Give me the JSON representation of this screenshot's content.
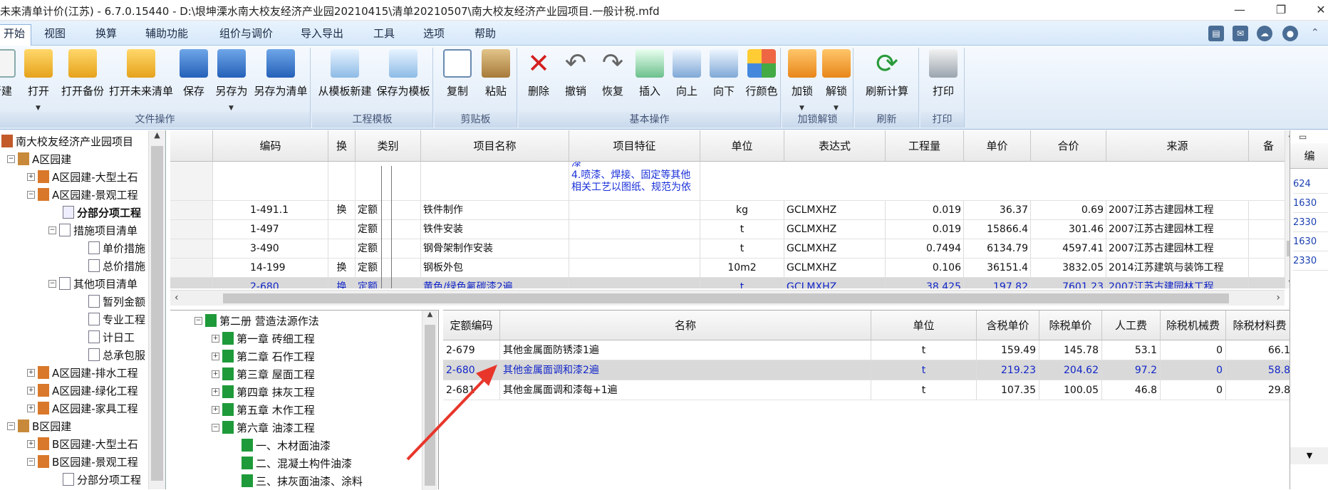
{
  "titlebar": {
    "text": "未来清单计价(江苏) - 6.7.0.15440 - D:\\垠坤溧水南大校友经济产业园20210415\\清单20210507\\南大校友经济产业园项目.一般计税.mfd"
  },
  "menu": [
    "开始",
    "视图",
    "换算",
    "辅助功能",
    "组价与调价",
    "导入导出",
    "工具",
    "选项",
    "帮助"
  ],
  "ribbon": {
    "groups": [
      "文件操作",
      "工程模板",
      "剪贴板",
      "基本操作",
      "加锁解锁",
      "刷新",
      "打印"
    ],
    "tools": [
      "新建",
      "打开",
      "打开备份",
      "打开未来清单",
      "保存",
      "另存为",
      "另存为清单",
      "从模板新建",
      "保存为模板",
      "复制",
      "粘贴",
      "删除",
      "撤销",
      "恢复",
      "插入",
      "向上",
      "向下",
      "行颜色",
      "加锁",
      "解锁",
      "刷新计算",
      "打印"
    ]
  },
  "tree": {
    "items": [
      "南大校友经济产业园项目",
      "A区园建",
      "A区园建-大型土石",
      "A区园建-景观工程",
      "分部分项工程",
      "措施项目清单",
      "单价措施",
      "总价措施",
      "其他项目清单",
      "暂列金额",
      "专业工程",
      "计日工",
      "总承包服",
      "A区园建-排水工程",
      "A区园建-绿化工程",
      "A区园建-家具工程",
      "B区园建",
      "B区园建-大型土石",
      "B区园建-景观工程",
      "分部分项工程"
    ]
  },
  "grid": {
    "headers": [
      "编码",
      "换",
      "类别",
      "项目名称",
      "项目特征",
      "单位",
      "表达式",
      "工程量",
      "单价",
      "合价",
      "来源",
      "备"
    ],
    "feature_text": [
      "漆",
      "4.喷漆、焊接、固定等其他",
      "相关工艺以图纸、规范为依"
    ],
    "rows": [
      {
        "code": "1-491.1",
        "swap": "换",
        "type": "定额",
        "name": "铁件制作",
        "unit": "kg",
        "expr": "GCLMXHZ",
        "qty": "0.019",
        "price": "36.37",
        "total": "0.69",
        "source": "2007江苏古建园林工程"
      },
      {
        "code": "1-497",
        "swap": "",
        "type": "定额",
        "name": "铁件安装",
        "unit": "t",
        "expr": "GCLMXHZ",
        "qty": "0.019",
        "price": "15866.4",
        "total": "301.46",
        "source": "2007江苏古建园林工程"
      },
      {
        "code": "3-490",
        "swap": "",
        "type": "定额",
        "name": "钢骨架制作安装",
        "unit": "t",
        "expr": "GCLMXHZ",
        "qty": "0.7494",
        "price": "6134.79",
        "total": "4597.41",
        "source": "2007江苏古建园林工程"
      },
      {
        "code": "14-199",
        "swap": "换",
        "type": "定额",
        "name": "钢板外包",
        "unit": "10m2",
        "expr": "GCLMXHZ",
        "qty": "0.106",
        "price": "36151.4",
        "total": "3832.05",
        "source": "2014江苏建筑与装饰工程"
      },
      {
        "code": "2-680",
        "swap": "换",
        "type": "定额",
        "name": "黄色/绿色氟碳漆2遍",
        "unit": "t",
        "expr": "GCLMXHZ",
        "qty": "38.425",
        "price": "197.82",
        "total": "7601.23",
        "source": "2007江苏古建园林工程"
      }
    ]
  },
  "quota_tree": {
    "items": [
      "第二册 营造法源作法",
      "第一章 砖细工程",
      "第二章 石作工程",
      "第三章 屋面工程",
      "第四章 抹灰工程",
      "第五章 木作工程",
      "第六章 油漆工程",
      "一、木材面油漆",
      "二、混凝土构件油漆",
      "三、抹灰面油漆、涂料"
    ]
  },
  "quota": {
    "headers": [
      "定额编码",
      "名称",
      "单位",
      "含税单价",
      "除税单价",
      "人工费",
      "除税机械费",
      "除税材料费"
    ],
    "rows": [
      {
        "code": "2-679",
        "name": "其他金属面防锈漆1遍",
        "unit": "t",
        "tax_price": "159.49",
        "notax_price": "145.78",
        "labor": "53.1",
        "machine": "0",
        "material": "66.1"
      },
      {
        "code": "2-680",
        "name": "其他金属面调和漆2遍",
        "unit": "t",
        "tax_price": "219.23",
        "notax_price": "204.62",
        "labor": "97.2",
        "machine": "0",
        "material": "58.8"
      },
      {
        "code": "2-681",
        "name": "其他金属面调和漆每+1遍",
        "unit": "t",
        "tax_price": "107.35",
        "notax_price": "100.05",
        "labor": "46.8",
        "machine": "0",
        "material": "29.8"
      }
    ]
  },
  "right": {
    "header": "编",
    "values": [
      "624",
      "1630",
      "2330",
      "1630",
      "2330"
    ]
  },
  "colors": {
    "selected_row": "#d9d9d9",
    "selected_text": "#1226c8",
    "annotation_arrow": "#e8362b"
  }
}
